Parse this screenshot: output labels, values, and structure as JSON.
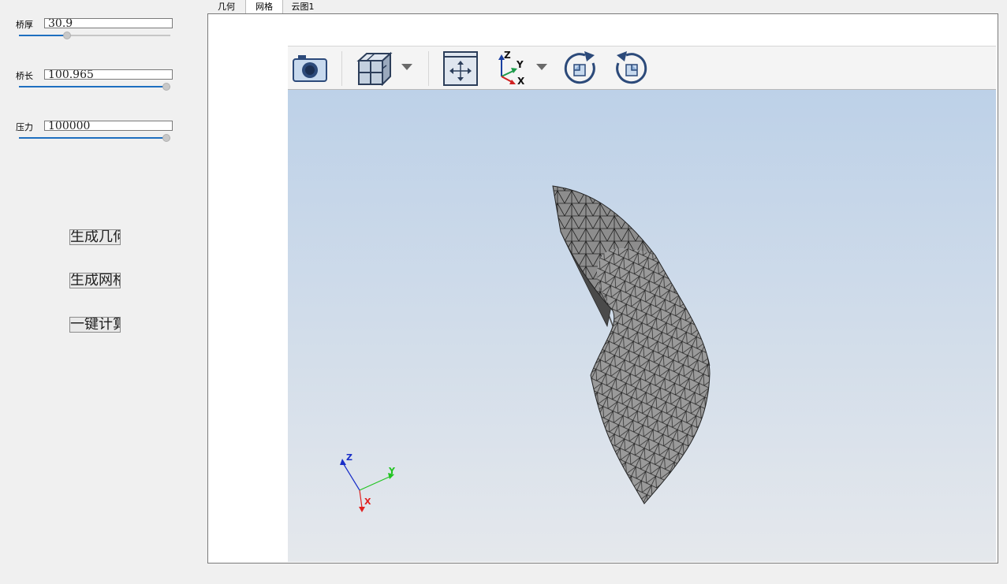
{
  "params": [
    {
      "label": "桥厚",
      "value": "30.9",
      "slider_fraction": 0.31
    },
    {
      "label": "桥长",
      "value": "100.965",
      "slider_fraction": 1.0
    },
    {
      "label": "压力",
      "value": "100000",
      "slider_fraction": 1.0
    }
  ],
  "buttons": {
    "generate_geometry": "生成几何",
    "generate_mesh": "生成网格",
    "one_click_compute": "一键计算"
  },
  "tabs": [
    {
      "label": "几何",
      "active": false
    },
    {
      "label": "网格",
      "active": true
    },
    {
      "label": "云图1",
      "active": false
    }
  ],
  "toolbar": {
    "icons": [
      "camera-icon",
      "view-cube-icon",
      "dropdown-arrow-icon",
      "fit-view-icon",
      "axes-orientation-icon",
      "dropdown-arrow-icon",
      "rotate-clockwise-icon",
      "rotate-counterclockwise-icon"
    ]
  },
  "axes_triad": {
    "x_label": "X",
    "y_label": "Y",
    "z_label": "Z"
  },
  "colors": {
    "slider_fill": "#1e6fc0",
    "viewport_top": "#bdd1e8",
    "viewport_bottom": "#e5e8ec",
    "mesh_fill": "#8f8f8f",
    "axis_x": "#e02020",
    "axis_y": "#22c422",
    "axis_z": "#1a2fc8"
  }
}
